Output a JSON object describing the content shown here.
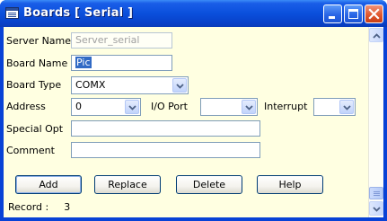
{
  "window": {
    "title": "Boards [ Serial ]",
    "controls": [
      "minimize-icon",
      "maximize-icon",
      "close-icon"
    ]
  },
  "form": {
    "server_name": {
      "label": "Server Name",
      "value": "Server_serial",
      "enabled": false
    },
    "board_name": {
      "label": "Board Name",
      "value": "Pic"
    },
    "board_type": {
      "label": "Board Type",
      "value": "COMX"
    },
    "address": {
      "label": "Address",
      "value": "0"
    },
    "io_port": {
      "label": "I/O Port",
      "value": ""
    },
    "interrupt": {
      "label": "Interrupt",
      "value": ""
    },
    "special_opt": {
      "label": "Special Opt",
      "value": ""
    },
    "comment": {
      "label": "Comment",
      "value": ""
    }
  },
  "buttons": {
    "add": "Add",
    "replace": "Replace",
    "delete": "Delete",
    "help": "Help"
  },
  "status": {
    "record_label": "Record :",
    "record_value": "3"
  },
  "colors": {
    "titlebar": "#0a4fdc",
    "client_bg": "#ffffe1",
    "selection": "#316ac5",
    "close_button": "#e0582f"
  }
}
